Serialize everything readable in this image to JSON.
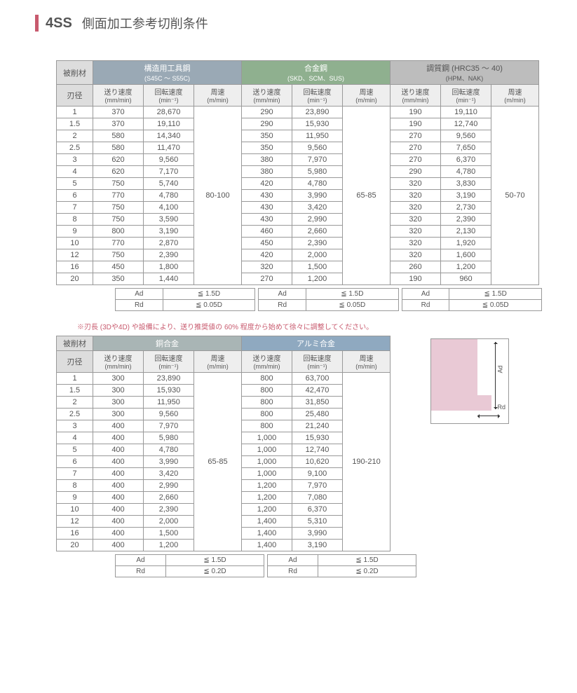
{
  "title": {
    "code": "4SS",
    "text": "側面加工参考切削条件"
  },
  "lbl": {
    "material": "被削材",
    "diameter": "刃径",
    "feed": "送り速度",
    "feed_u": "(mm/min)",
    "rpm": "回転速度",
    "rpm_u": "(min⁻¹)",
    "vel": "周速",
    "vel_u": "(m/min)",
    "ad": "Ad",
    "rd": "Rd"
  },
  "mats1": {
    "a": {
      "name": "構造用工具鋼",
      "sub": "(S45C ～ S55C)",
      "vel": "80-100",
      "ad": "≦ 1.5D",
      "rd": "≦ 0.05D"
    },
    "b": {
      "name": "合金鋼",
      "sub": "(SKD、SCM、SUS)",
      "vel": "65-85",
      "ad": "≦ 1.5D",
      "rd": "≦ 0.05D"
    },
    "c": {
      "name": "調質鋼 (HRC35 ～ 40)",
      "sub": "(HPM、NAK)",
      "vel": "50-70",
      "ad": "≦ 1.5D",
      "rd": "≦ 0.05D"
    }
  },
  "mats2": {
    "d": {
      "name": "銅合金",
      "vel": "65-85",
      "ad": "≦ 1.5D",
      "rd": "≦ 0.2D"
    },
    "e": {
      "name": "アルミ合金",
      "vel": "190-210",
      "ad": "≦ 1.5D",
      "rd": "≦ 0.2D"
    }
  },
  "chart_data": [
    {
      "type": "table",
      "title": "側面加工参考切削条件 上段",
      "diameters": [
        "1",
        "1.5",
        "2",
        "2.5",
        "3",
        "4",
        "5",
        "6",
        "7",
        "8",
        "9",
        "10",
        "12",
        "16",
        "20"
      ],
      "series": [
        {
          "name": "構造用工具鋼 送り速度 mm/min",
          "values": [
            370,
            370,
            580,
            580,
            620,
            620,
            750,
            770,
            750,
            750,
            800,
            770,
            750,
            450,
            350
          ]
        },
        {
          "name": "構造用工具鋼 回転速度 min-1",
          "values": [
            28670,
            19110,
            14340,
            11470,
            9560,
            7170,
            5740,
            4780,
            4100,
            3590,
            3190,
            2870,
            2390,
            1800,
            1440
          ]
        },
        {
          "name": "合金鋼 送り速度 mm/min",
          "values": [
            290,
            290,
            350,
            350,
            380,
            380,
            420,
            430,
            430,
            430,
            460,
            450,
            420,
            320,
            270
          ]
        },
        {
          "name": "合金鋼 回転速度 min-1",
          "values": [
            23890,
            15930,
            11950,
            9560,
            7970,
            5980,
            4780,
            3990,
            3420,
            2990,
            2660,
            2390,
            2000,
            1500,
            1200
          ]
        },
        {
          "name": "調質鋼 送り速度 mm/min",
          "values": [
            190,
            190,
            270,
            270,
            270,
            290,
            320,
            320,
            320,
            320,
            320,
            320,
            320,
            260,
            190
          ]
        },
        {
          "name": "調質鋼 回転速度 min-1",
          "values": [
            19110,
            12740,
            9560,
            7650,
            6370,
            4780,
            3830,
            3190,
            2730,
            2390,
            2130,
            1920,
            1600,
            1200,
            960
          ]
        }
      ]
    },
    {
      "type": "table",
      "title": "側面加工参考切削条件 下段",
      "diameters": [
        "1",
        "1.5",
        "2",
        "2.5",
        "3",
        "4",
        "5",
        "6",
        "7",
        "8",
        "9",
        "10",
        "12",
        "16",
        "20"
      ],
      "series": [
        {
          "name": "銅合金 送り速度 mm/min",
          "values": [
            300,
            300,
            300,
            300,
            400,
            400,
            400,
            400,
            400,
            400,
            400,
            400,
            400,
            400,
            400
          ]
        },
        {
          "name": "銅合金 回転速度 min-1",
          "values": [
            23890,
            15930,
            11950,
            9560,
            7970,
            5980,
            4780,
            3990,
            3420,
            2990,
            2660,
            2390,
            2000,
            1500,
            1200
          ]
        },
        {
          "name": "アルミ合金 送り速度 mm/min",
          "values": [
            800,
            800,
            800,
            800,
            800,
            1000,
            1000,
            1000,
            1000,
            1200,
            1200,
            1200,
            1400,
            1400,
            1400
          ]
        },
        {
          "name": "アルミ合金 回転速度 min-1",
          "values": [
            63700,
            42470,
            31850,
            25480,
            21240,
            15930,
            12740,
            10620,
            9100,
            7970,
            7080,
            6370,
            5310,
            3990,
            3190
          ]
        }
      ]
    }
  ],
  "note": "※刃長 (3Dや4D) や設備により、送り推奨値の 60% 程度から始めて徐々に調整してください。",
  "diagram": {
    "ad": "Ad",
    "rd": "Rd"
  }
}
